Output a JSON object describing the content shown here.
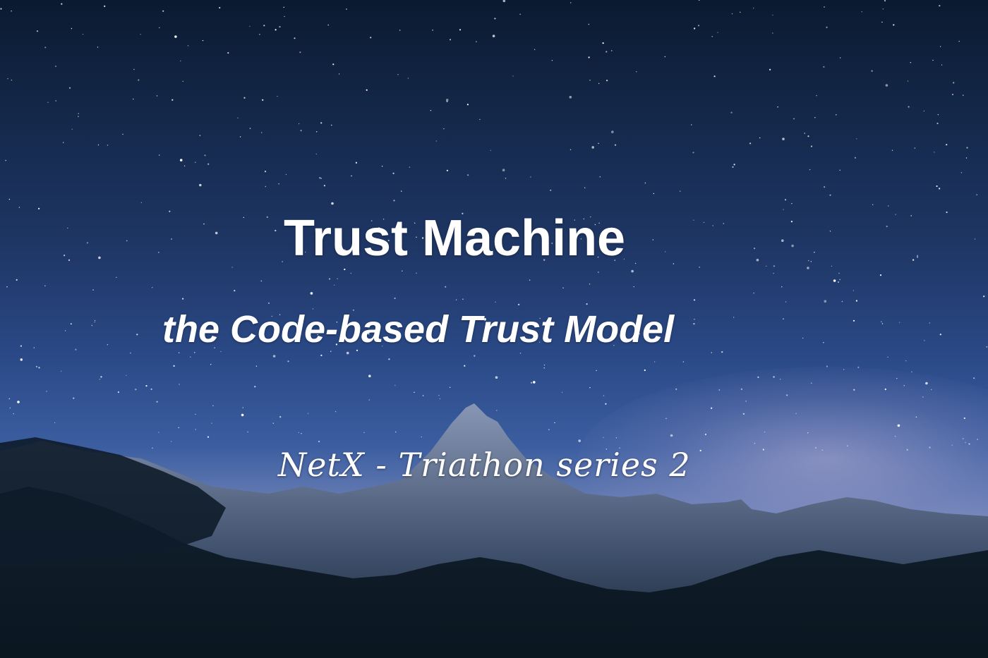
{
  "poster": {
    "title": "Trust Machine",
    "subtitle": "the Code-based Trust Model",
    "tagline": "NetX - Triathon series 2"
  },
  "colors": {
    "sky_top": "#0a1a30",
    "sky_mid": "#2b4a88",
    "horizon_glow": "#9aa3c8",
    "mountain_dark": "#0d1a24",
    "mountain_snow": "#5e6f8c",
    "text": "#ffffff"
  }
}
